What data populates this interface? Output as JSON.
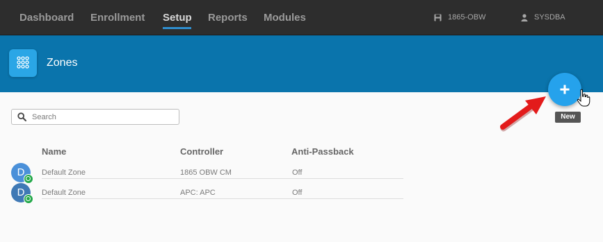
{
  "nav": {
    "items": [
      {
        "label": "Dashboard"
      },
      {
        "label": "Enrollment"
      },
      {
        "label": "Setup"
      },
      {
        "label": "Reports"
      },
      {
        "label": "Modules"
      }
    ],
    "active": "Setup",
    "site": "1865-OBW",
    "user": "SYSDBA"
  },
  "page": {
    "title": "Zones"
  },
  "fab": {
    "symbol": "+",
    "tooltip": "New"
  },
  "search": {
    "placeholder": "Search",
    "value": ""
  },
  "table": {
    "headers": {
      "name": "Name",
      "controller": "Controller",
      "antipassback": "Anti-Passback"
    },
    "rows": [
      {
        "initial": "D",
        "name": "Default Zone",
        "controller": "1865 OBW CM",
        "antipassback": "Off",
        "avatar_color": "#4a90d9"
      },
      {
        "initial": "D",
        "name": "Default Zone",
        "controller": "APC: APC",
        "antipassback": "Off",
        "avatar_color": "#3f79b5"
      }
    ]
  },
  "colors": {
    "nav_bg": "#2d2d2d",
    "banner_bg": "#0a74ac",
    "accent": "#25a2ec",
    "status_green": "#24a84a",
    "arrow_red": "#e31b1b"
  }
}
